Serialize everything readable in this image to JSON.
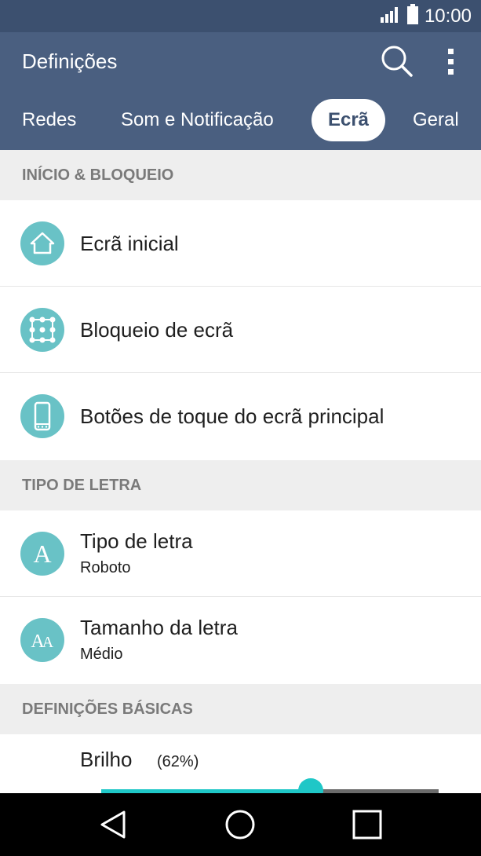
{
  "status_bar": {
    "time": "10:00",
    "icons": [
      "signal-icon",
      "battery-icon"
    ]
  },
  "app_bar": {
    "title": "Definições",
    "icons": [
      "search-icon",
      "more-vert-icon"
    ]
  },
  "tabs": [
    {
      "label": "Redes",
      "selected": false
    },
    {
      "label": "Som e Notificação",
      "selected": false
    },
    {
      "label": "Ecrã",
      "selected": true
    },
    {
      "label": "Geral",
      "selected": false
    }
  ],
  "sections": [
    {
      "header": "INÍCIO & BLOQUEIO",
      "items": [
        {
          "title": "Ecrã inicial",
          "icon": "home-icon"
        },
        {
          "title": "Bloqueio de ecrã",
          "icon": "pattern-lock-icon"
        },
        {
          "title": "Botões de toque do ecrã principal",
          "icon": "phone-icon"
        }
      ]
    },
    {
      "header": "TIPO DE LETRA",
      "items": [
        {
          "title": "Tipo de letra",
          "subtitle": "Roboto",
          "icon": "font-type-icon"
        },
        {
          "title": "Tamanho da letra",
          "subtitle": "Médio",
          "icon": "font-size-icon"
        }
      ]
    },
    {
      "header": "DEFINIÇÕES BÁSICAS",
      "brightness": {
        "label": "Brilho",
        "value_text": "(62%)",
        "level": 0.62
      }
    }
  ],
  "nav_bar": {
    "icons": [
      "back-icon",
      "home-nav-icon",
      "recent-apps-icon"
    ]
  },
  "colors": {
    "status_bar": "#3c506f",
    "app_bar": "#4a5f80",
    "accent": "#69c2c6",
    "slider": "#1fc7c7",
    "section_bg": "#eeeeee"
  }
}
